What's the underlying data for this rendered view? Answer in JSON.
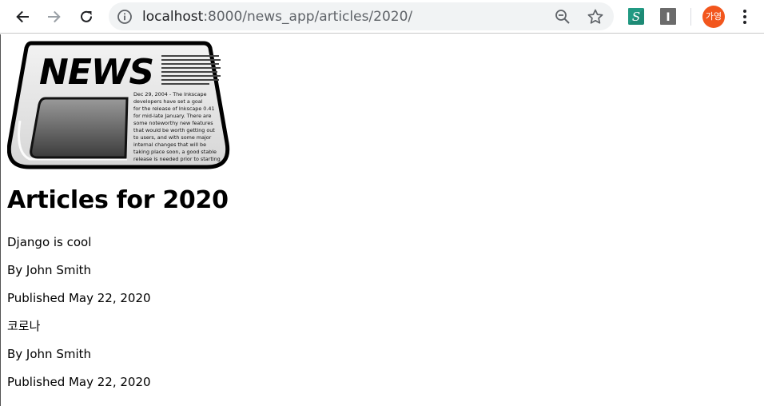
{
  "browser": {
    "url_host": "localhost",
    "url_path": ":8000/news_app/articles/2020/",
    "avatar_text": "가영",
    "ext2_text": "I"
  },
  "logo": {
    "headline": "NEWS",
    "body_text": [
      "Dec 29, 2004 - The Inkscape",
      "developers have set a goal",
      "for the release of Inkscape 0.41",
      "for mid-late January. There are",
      "some noteworthy new features",
      "that would be worth getting out",
      "to users, and with some major",
      "internal changes that will be",
      "taking place soon, a good stable",
      "release is needed prior to starting"
    ]
  },
  "main": {
    "heading": "Articles for 2020",
    "articles": [
      {
        "title": "Django is cool",
        "byline": "By John Smith",
        "published": "Published May 22, 2020"
      },
      {
        "title": "코로나",
        "byline": "By John Smith",
        "published": "Published May 22, 2020"
      }
    ]
  }
}
